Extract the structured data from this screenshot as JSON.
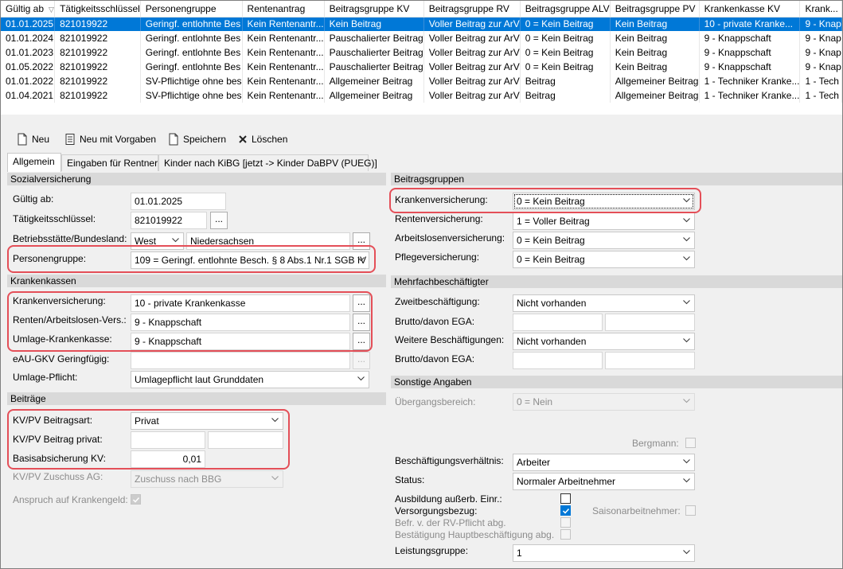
{
  "table": {
    "columns": [
      "Gültig ab",
      "Tätigkeitsschlüssel",
      "Personengruppe",
      "Rentenantrag",
      "Beitragsgruppe KV",
      "Beitragsgruppe RV",
      "Beitragsgruppe ALV",
      "Beitragsgruppe PV",
      "Krankenkasse KV",
      "Krank..."
    ],
    "rows": [
      [
        "01.01.2025",
        "821019922",
        "Geringf. entlohnte Bes",
        "Kein Rentenantr...",
        "Kein Beitrag",
        "Voller Beitrag zur ArV",
        "0 = Kein Beitrag",
        "Kein Beitrag",
        "10 - private Kranke...",
        "9 - Knap"
      ],
      [
        "01.01.2024",
        "821019922",
        "Geringf. entlohnte Bes",
        "Kein Rentenantr...",
        "Pauschalierter Beitrag",
        "Voller Beitrag zur ArV",
        "0 = Kein Beitrag",
        "Kein Beitrag",
        "9 - Knappschaft",
        "9 - Knap"
      ],
      [
        "01.01.2023",
        "821019922",
        "Geringf. entlohnte Bes",
        "Kein Rentenantr...",
        "Pauschalierter Beitrag",
        "Voller Beitrag zur ArV",
        "0 = Kein Beitrag",
        "Kein Beitrag",
        "9 - Knappschaft",
        "9 - Knap"
      ],
      [
        "01.05.2022",
        "821019922",
        "Geringf. entlohnte Bes",
        "Kein Rentenantr...",
        "Pauschalierter Beitrag",
        "Voller Beitrag zur ArV",
        "0 = Kein Beitrag",
        "Kein Beitrag",
        "9 - Knappschaft",
        "9 - Knap"
      ],
      [
        "01.01.2022",
        "821019922",
        "SV-Pflichtige ohne bes",
        "Kein Rentenantr...",
        "Allgemeiner Beitrag",
        "Voller Beitrag zur ArV",
        "Beitrag",
        "Allgemeiner Beitrag",
        "1 - Techniker Kranke...",
        "1 - Tech"
      ],
      [
        "01.04.2021",
        "821019922",
        "SV-Pflichtige ohne bes",
        "Kein Rentenantr...",
        "Allgemeiner Beitrag",
        "Voller Beitrag zur ArV",
        "Beitrag",
        "Allgemeiner Beitrag",
        "1 - Techniker Kranke...",
        "1 - Tech"
      ]
    ],
    "selected_row": 0
  },
  "toolbar": {
    "new_label": "Neu",
    "new_defaults_label": "Neu mit Vorgaben",
    "save_label": "Speichern",
    "delete_label": "Löschen"
  },
  "tabs": [
    "Allgemein",
    "Eingaben für Rentner",
    "Kinder nach KiBG [jetzt -> Kinder DaBPV (PUEG)]"
  ],
  "sozialversicherung": {
    "header": "Sozialversicherung",
    "gueltig_ab_label": "Gültig ab:",
    "gueltig_ab_value": "01.01.2025",
    "taetigkeit_label": "Tätigkeitsschlüssel:",
    "taetigkeit_value": "821019922",
    "betriebsstaette_label": "Betriebsstätte/Bundesland:",
    "betriebsstaette_value": "West",
    "bundesland_value": "Niedersachsen",
    "personengruppe_label": "Personengruppe:",
    "personengruppe_value": "109 = Geringf. entlohnte Besch. § 8 Abs.1 Nr.1 SGB IV"
  },
  "krankenkassen": {
    "header": "Krankenkassen",
    "kv_label": "Krankenversicherung:",
    "kv_value": "10 - private Krankenkasse",
    "rv_label": "Renten/Arbeitslosen-Vers.:",
    "rv_value": "9 - Knappschaft",
    "umlage_label": "Umlage-Krankenkasse:",
    "umlage_value": "9 - Knappschaft",
    "eau_label": "eAU-GKV Geringfügig:",
    "eau_value": "",
    "umlagepflicht_label": "Umlage-Pflicht:",
    "umlagepflicht_value": "Umlagepflicht laut Grunddaten"
  },
  "beitraege": {
    "header": "Beiträge",
    "art_label": "KV/PV Beitragsart:",
    "art_value": "Privat",
    "privat_label": "KV/PV Beitrag privat:",
    "privat_value1": "",
    "privat_value2": "",
    "basis_label": "Basisabsicherung KV:",
    "basis_value": "0,01",
    "zuschuss_label": "KV/PV Zuschuss AG:",
    "zuschuss_value": "Zuschuss nach BBG",
    "anspruch_label": "Anspruch auf Krankengeld:"
  },
  "beitragsgruppen": {
    "header": "Beitragsgruppen",
    "kv_label": "Krankenversicherung:",
    "kv_value": "0 = Kein Beitrag",
    "rv_label": "Rentenversicherung:",
    "rv_value": "1 = Voller Beitrag",
    "alv_label": "Arbeitslosenversicherung:",
    "alv_value": "0 = Kein Beitrag",
    "pv_label": "Pflegeversicherung:",
    "pv_value": "0 = Kein Beitrag"
  },
  "mehrfach": {
    "header": "Mehrfachbeschäftigter",
    "zweit_label": "Zweitbeschäftigung:",
    "zweit_value": "Nicht vorhanden",
    "brutto1_label": "Brutto/davon EGA:",
    "weitere_label": "Weitere Beschäftigungen:",
    "weitere_value": "Nicht vorhanden",
    "brutto2_label": "Brutto/davon EGA:"
  },
  "sonstige": {
    "header": "Sonstige Angaben",
    "uebergang_label": "Übergangsbereich:",
    "uebergang_value": "0 = Nein",
    "bergmann_label": "Bergmann:",
    "verhaeltnis_label": "Beschäftigungsverhältnis:",
    "verhaeltnis_value": "Arbeiter",
    "status_label": "Status:",
    "status_value": "Normaler Arbeitnehmer",
    "ausbildung_label": "Ausbildung außerb. Einr.:",
    "versorgung_label": "Versorgungsbezug:",
    "saison_label": "Saisonarbeitnehmer:",
    "befr_label": "Befr. v. der RV-Pflicht abg.",
    "bestaetigung_label": "Bestätigung Hauptbeschäftigung abg.",
    "leistung_label": "Leistungsgruppe:",
    "leistung_value": "1"
  },
  "colors": {
    "selection": "#0078d7",
    "highlight": "#e44f58",
    "section_header": "#d9d9d9"
  }
}
